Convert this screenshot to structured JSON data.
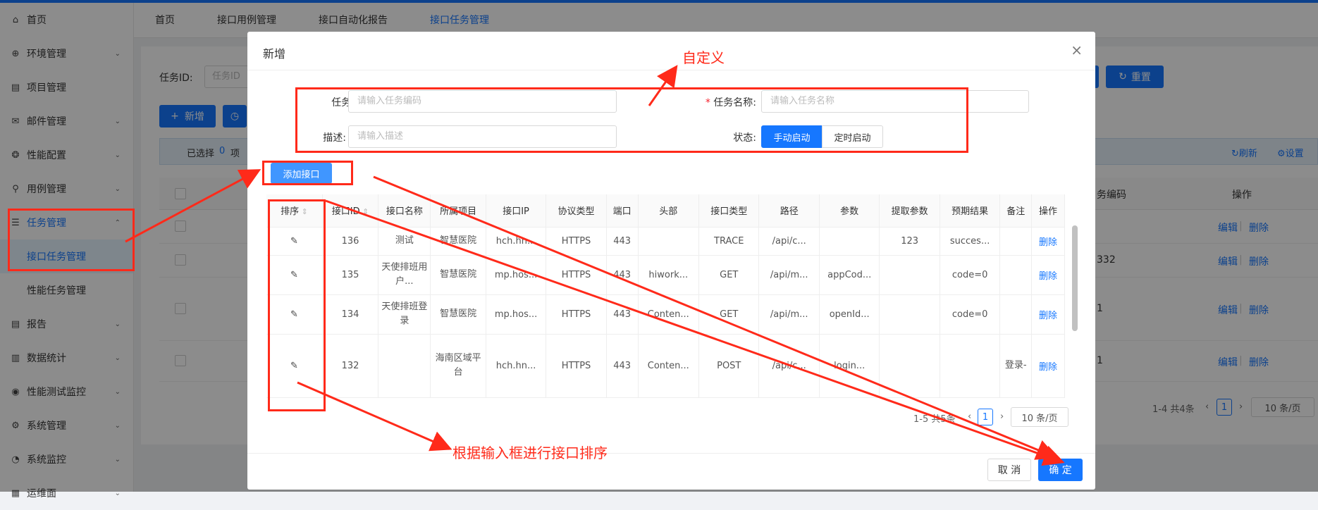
{
  "sidebar": {
    "items": [
      {
        "label": "首页",
        "icon": "home-icon",
        "glyph": "⌂",
        "chevron": ""
      },
      {
        "label": "环境管理",
        "icon": "globe-icon",
        "glyph": "⊕",
        "chevron": "⌄"
      },
      {
        "label": "项目管理",
        "icon": "project-icon",
        "glyph": "▤",
        "chevron": ""
      },
      {
        "label": "邮件管理",
        "icon": "mail-icon",
        "glyph": "✉",
        "chevron": "⌄"
      },
      {
        "label": "性能配置",
        "icon": "settings-cube-icon",
        "glyph": "❂",
        "chevron": "⌄"
      },
      {
        "label": "用例管理",
        "icon": "case-icon",
        "glyph": "⚲",
        "chevron": "⌄"
      },
      {
        "label": "任务管理",
        "icon": "task-list-icon",
        "glyph": "☰",
        "chevron": "⌃"
      }
    ],
    "task_sub": [
      "接口任务管理",
      "性能任务管理"
    ],
    "items_after": [
      {
        "label": "报告",
        "icon": "report-icon",
        "glyph": "▤",
        "chevron": "⌄"
      },
      {
        "label": "数据统计",
        "icon": "chart-icon",
        "glyph": "▥",
        "chevron": "⌄"
      },
      {
        "label": "性能测试监控",
        "icon": "eye-icon",
        "glyph": "◉",
        "chevron": "⌄"
      },
      {
        "label": "系统管理",
        "icon": "gear-icon",
        "glyph": "⚙",
        "chevron": "⌄"
      },
      {
        "label": "系统监控",
        "icon": "dashboard-icon",
        "glyph": "◔",
        "chevron": "⌄"
      },
      {
        "label": "运维面",
        "icon": "ops-icon",
        "glyph": "▦",
        "chevron": "⌄"
      }
    ]
  },
  "tabs": [
    "首页",
    "接口用例管理",
    "接口自动化报告",
    "接口任务管理"
  ],
  "background": {
    "task_id_label": "任务ID:",
    "task_id_placeholder": "任务ID",
    "add_label": "新增",
    "reset_label": "重置",
    "selected_prefix": "已选择",
    "selected_count": "0",
    "selected_suffix": "项",
    "refresh_label": "刷新",
    "settings_label": "设置",
    "col_task_code": "务编码",
    "col_actions": "操作",
    "row_codes": [
      "",
      "332",
      "1",
      "1"
    ],
    "edit_label": "编辑",
    "delete_label": "删除",
    "pager_total": "1-4 共4条",
    "pager_page": "1",
    "pager_size": "10 条/页"
  },
  "modal": {
    "title": "新增",
    "task_code_label": "任务编码:",
    "task_code_placeholder": "请输入任务编码",
    "task_name_required": "*",
    "task_name_label": "任务名称:",
    "task_name_placeholder": "请输入任务名称",
    "desc_label": "描述:",
    "desc_placeholder": "请输入描述",
    "status_label": "状态:",
    "status_manual": "手动启动",
    "status_timed": "定时启动",
    "add_api_label": "添加接口",
    "columns": [
      "排序",
      "接口ID",
      "接口名称",
      "所属项目",
      "接口IP",
      "协议类型",
      "端口",
      "头部",
      "接口类型",
      "路径",
      "参数",
      "提取参数",
      "预期结果",
      "备注",
      "操作"
    ],
    "rows": [
      {
        "id": "136",
        "name": "测试",
        "project": "智慧医院",
        "ip": "hch.hn...",
        "proto": "HTTPS",
        "port": "443",
        "header": "",
        "type": "TRACE",
        "path": "/api/c...",
        "params": "",
        "extract": "123",
        "expect": "succes...",
        "remark": "",
        "op": "删除"
      },
      {
        "id": "135",
        "name": "天使排班用户...",
        "project": "智慧医院",
        "ip": "mp.hos...",
        "proto": "HTTPS",
        "port": "443",
        "header": "hiwork...",
        "type": "GET",
        "path": "/api/m...",
        "params": "appCod...",
        "extract": "",
        "expect": "code=0",
        "remark": "",
        "op": "删除"
      },
      {
        "id": "134",
        "name": "天使排班登录",
        "project": "智慧医院",
        "ip": "mp.hos...",
        "proto": "HTTPS",
        "port": "443",
        "header": "Conten...",
        "type": "GET",
        "path": "/api/m...",
        "params": "openId...",
        "extract": "",
        "expect": "code=0",
        "remark": "",
        "op": "删除"
      },
      {
        "id": "132",
        "name": "",
        "project": "海南区域平台",
        "ip": "hch.hn...",
        "proto": "HTTPS",
        "port": "443",
        "header": "Conten...",
        "type": "POST",
        "path": "/api/c...",
        "params": "login...",
        "extract": "",
        "expect": "",
        "remark": "登录-",
        "op": "删除"
      }
    ],
    "pager_total": "1-5 共5条",
    "pager_page": "1",
    "pager_size": "10 条/页",
    "cancel_label": "取 消",
    "ok_label": "确 定"
  },
  "annotations": {
    "custom": "自定义",
    "sort_note": "根据输入框进行接口排序"
  },
  "colors": {
    "accent": "#1677ff",
    "annotation": "#ff2a1a"
  }
}
